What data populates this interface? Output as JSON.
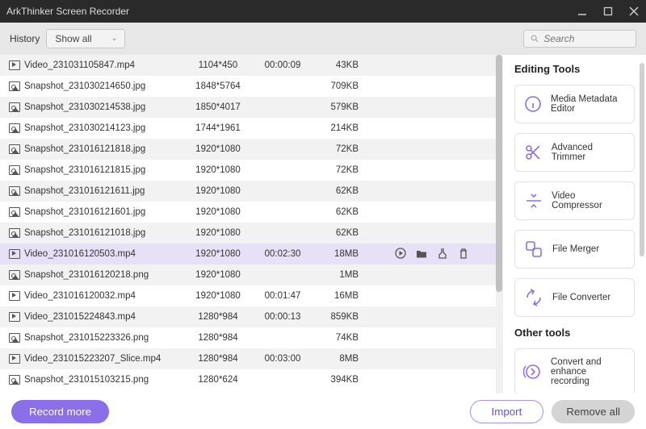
{
  "app": {
    "title": "ArkThinker Screen Recorder"
  },
  "toolbar": {
    "history_label": "History",
    "showall_label": "Show all",
    "search_placeholder": "Search"
  },
  "rows": [
    {
      "type": "video",
      "name": "Video_231031105847.mp4",
      "dim": "1104*450",
      "dur": "00:00:09",
      "size": "43KB",
      "sel": false
    },
    {
      "type": "img",
      "name": "Snapshot_231030214650.jpg",
      "dim": "1848*5764",
      "dur": "",
      "size": "709KB",
      "sel": false
    },
    {
      "type": "img",
      "name": "Snapshot_231030214538.jpg",
      "dim": "1850*4017",
      "dur": "",
      "size": "579KB",
      "sel": false
    },
    {
      "type": "img",
      "name": "Snapshot_231030214123.jpg",
      "dim": "1744*1961",
      "dur": "",
      "size": "214KB",
      "sel": false
    },
    {
      "type": "img",
      "name": "Snapshot_231016121818.jpg",
      "dim": "1920*1080",
      "dur": "",
      "size": "72KB",
      "sel": false
    },
    {
      "type": "img",
      "name": "Snapshot_231016121815.jpg",
      "dim": "1920*1080",
      "dur": "",
      "size": "72KB",
      "sel": false
    },
    {
      "type": "img",
      "name": "Snapshot_231016121611.jpg",
      "dim": "1920*1080",
      "dur": "",
      "size": "62KB",
      "sel": false
    },
    {
      "type": "img",
      "name": "Snapshot_231016121601.jpg",
      "dim": "1920*1080",
      "dur": "",
      "size": "62KB",
      "sel": false
    },
    {
      "type": "img",
      "name": "Snapshot_231016121018.jpg",
      "dim": "1920*1080",
      "dur": "",
      "size": "62KB",
      "sel": false
    },
    {
      "type": "video",
      "name": "Video_231016120503.mp4",
      "dim": "1920*1080",
      "dur": "00:02:30",
      "size": "18MB",
      "sel": true
    },
    {
      "type": "img",
      "name": "Snapshot_231016120218.png",
      "dim": "1920*1080",
      "dur": "",
      "size": "1MB",
      "sel": false
    },
    {
      "type": "video",
      "name": "Video_231016120032.mp4",
      "dim": "1920*1080",
      "dur": "00:01:47",
      "size": "16MB",
      "sel": false
    },
    {
      "type": "video",
      "name": "Video_231015224843.mp4",
      "dim": "1280*984",
      "dur": "00:00:13",
      "size": "859KB",
      "sel": false
    },
    {
      "type": "img",
      "name": "Snapshot_231015223326.png",
      "dim": "1280*984",
      "dur": "",
      "size": "74KB",
      "sel": false
    },
    {
      "type": "video",
      "name": "Video_231015223207_Slice.mp4",
      "dim": "1280*984",
      "dur": "00:03:00",
      "size": "8MB",
      "sel": false
    },
    {
      "type": "img",
      "name": "Snapshot_231015103215.png",
      "dim": "1280*624",
      "dur": "",
      "size": "394KB",
      "sel": false
    }
  ],
  "row_actions": {
    "play": "play-icon",
    "folder": "folder-icon",
    "tool": "tool-icon",
    "trash": "trash-icon"
  },
  "sidebar": {
    "editing_tools_label": "Editing Tools",
    "tools": [
      {
        "id": "metadata",
        "label": "Media Metadata Editor"
      },
      {
        "id": "trimmer",
        "label": "Advanced Trimmer"
      },
      {
        "id": "compress",
        "label": "Video Compressor"
      },
      {
        "id": "merger",
        "label": "File Merger"
      },
      {
        "id": "convert",
        "label": "File Converter"
      }
    ],
    "other_tools_label": "Other tools",
    "other": [
      {
        "id": "enhance",
        "label": "Convert and enhance recording"
      }
    ]
  },
  "footer": {
    "record_more": "Record more",
    "import": "Import",
    "remove_all": "Remove all"
  }
}
